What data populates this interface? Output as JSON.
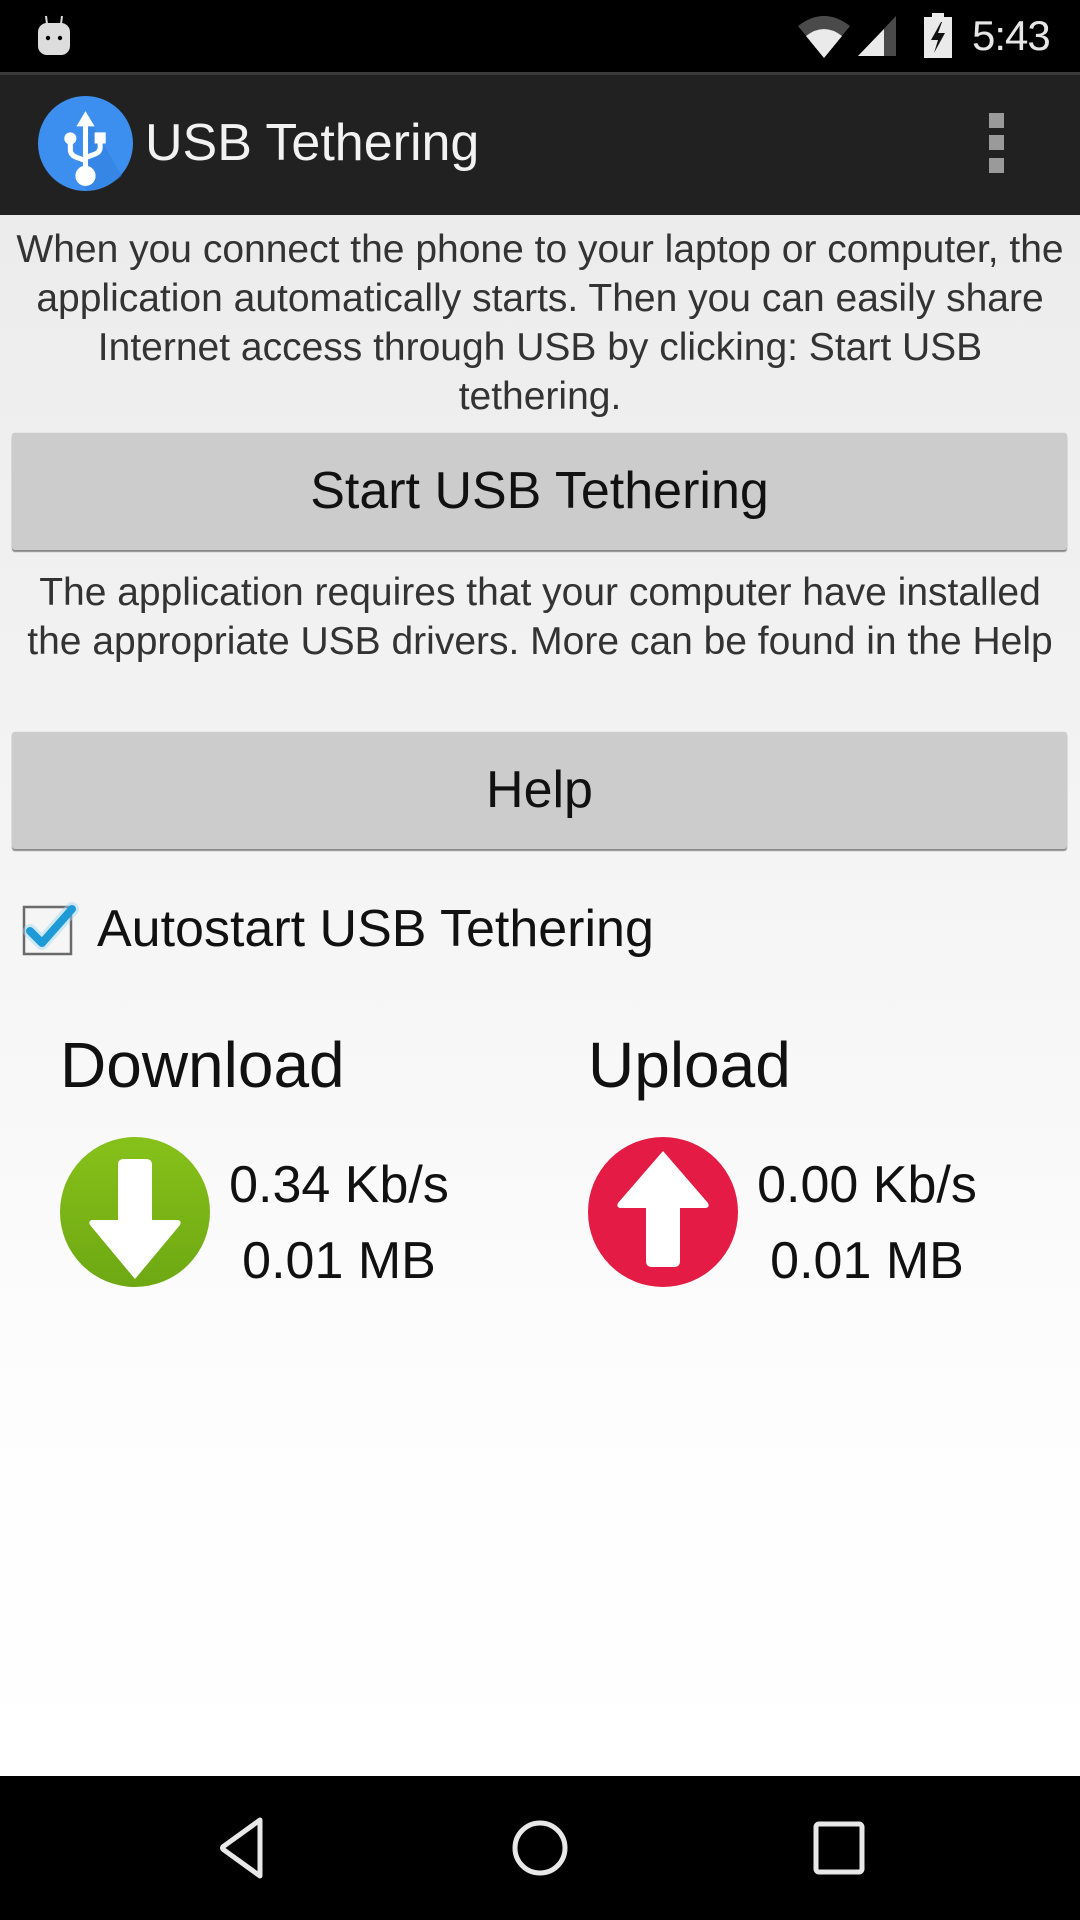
{
  "status_bar": {
    "time": "5:43",
    "icons": [
      "android-robot-icon",
      "wifi-icon",
      "cell-signal-icon",
      "battery-charging-icon"
    ]
  },
  "app_bar": {
    "title": "USB Tethering",
    "logo_icon": "usb-icon",
    "overflow_icon": "more-vert-icon",
    "logo_color": "#3d8fef"
  },
  "main": {
    "intro_text": "When you connect the phone to your laptop or computer, the application automatically starts. Then you can easily share Internet access through USB by clicking: Start USB tethering.",
    "start_button_label": "Start USB Tethering",
    "drivers_text": "The application requires that your computer have installed the appropriate USB drivers. More can be found in the Help",
    "help_button_label": "Help",
    "autostart": {
      "label": "Autostart USB Tethering",
      "checked": true,
      "check_color": "#1e9ad6"
    }
  },
  "stats": {
    "download": {
      "heading": "Download",
      "speed": "0.34 Kb/s",
      "total": "0.01 MB",
      "icon": "arrow-down-circle-icon",
      "color": "#7ab317"
    },
    "upload": {
      "heading": "Upload",
      "speed": "0.00 Kb/s",
      "total": "0.01 MB",
      "icon": "arrow-up-circle-icon",
      "color": "#e31b45"
    }
  },
  "nav_bar": {
    "buttons": [
      "back-icon",
      "home-icon",
      "recents-icon"
    ]
  }
}
